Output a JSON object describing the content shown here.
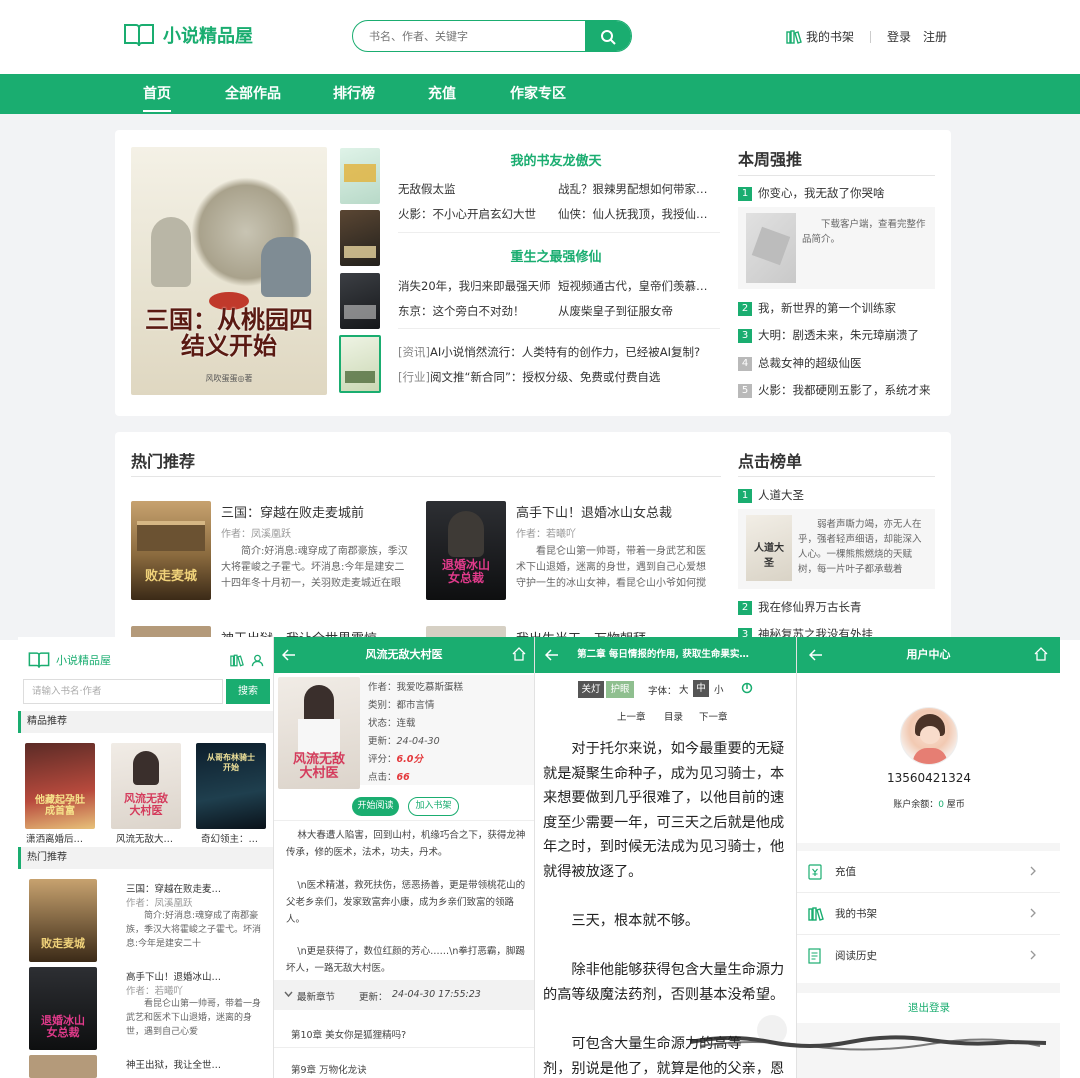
{
  "colors": {
    "brand": "#1aad70",
    "rank1": "#1aad70",
    "rank_other": "#b9b9b9",
    "red": "#e4393c"
  },
  "desktop": {
    "logo_text": "小说精品屋",
    "search_placeholder": "书名、作者、关键字",
    "header_links": {
      "bookshelf": "我的书架",
      "login": "登录",
      "register": "注册"
    },
    "nav": [
      "首页",
      "全部作品",
      "排行榜",
      "充值",
      "作家专区"
    ],
    "banner": {
      "cover_title": "三国：从桃园四结义开始",
      "cover_author": "风吹蛋蛋◎著"
    },
    "featured": [
      {
        "title": "我的书友龙傲天",
        "links": [
          [
            "无敌假太监",
            "战乱？狠辣男配想如何带家…"
          ],
          [
            "火影：不小心开启玄幻大世",
            "仙侠：仙人抚我顶，我授仙…"
          ]
        ]
      },
      {
        "title": "重生之最强修仙",
        "links": [
          [
            "消失20年，我归来即最强天师",
            "短视频通古代，皇帝们羡慕…"
          ],
          [
            "东京：这个旁白不对劲！",
            "从废柴皇子到征服女帝"
          ]
        ]
      }
    ],
    "news": [
      {
        "tag": "[资讯]",
        "text": "AI小说悄然流行：人类特有的创作力，已经被AI复制?"
      },
      {
        "tag": "[行业]",
        "text": "阅文推“新合同”：授权分级、免费或付费自选"
      }
    ],
    "weekly": {
      "title": "本周强推",
      "first": {
        "rank": "1",
        "title": "你变心，我无敌了你哭啥",
        "desc": "下载客户端，查看完整作品简介。"
      },
      "rest": [
        {
          "rank": "2",
          "title": "我，新世界的第一个训练家"
        },
        {
          "rank": "3",
          "title": "大明：剧透未来，朱元璋崩溃了"
        },
        {
          "rank": "4",
          "title": "总裁女神的超级仙医"
        },
        {
          "rank": "5",
          "title": "火影：我都硬刚五影了，系统才来"
        }
      ]
    },
    "hot": {
      "title": "热门推荐",
      "books": [
        {
          "title": "三国：穿越在败走麦城前",
          "author": "作者：凤溪凰跃",
          "desc": "简介:好消息:魂穿成了南郡豪族，季汉大将霍峻之子霍弋。坏消息:今年是建安二十四年冬十月初一，关羽败走麦城近在眼前。"
        },
        {
          "title": "高手下山！退婚冰山女总裁",
          "author": "作者：若曦吖",
          "desc": "看昆仑山第一帅哥，带着一身武艺和医术下山退婚，迷离的身世，遇到自己心爱想守护一生的冰山女神，看昆仑山小爷如何搅"
        }
      ],
      "partial": [
        "神王出狱，我让全世界震惊",
        "我出生当天，万物朝拜"
      ]
    },
    "click_rank": {
      "title": "点击榜单",
      "first": {
        "rank": "1",
        "title": "人道大圣",
        "desc": "弱者声嘶力竭，亦无人在乎，强者轻声细语，却能深入人心。一棵熊熊燃烧的天赋树，每一片叶子都承载着"
      },
      "rest": [
        {
          "rank": "2",
          "title": "我在修仙界万古长青"
        },
        {
          "rank": "3",
          "title": "神秘复苏之我没有外挂"
        }
      ]
    }
  },
  "m1": {
    "logo": "小说精品屋",
    "search_placeholder": "请输入书名·作者",
    "search_btn": "搜索",
    "sec1": "精品推荐",
    "covers": [
      "潇洒离婚后…",
      "风流无敌大…",
      "奇幻领主：…"
    ],
    "sec2": "热门推荐",
    "books": [
      {
        "title": "三国：穿越在败走麦…",
        "author": "作者：凤溪凰跃",
        "desc": "简介:好消息:魂穿成了南郡豪族，季汉大将霍峻之子霍弋。坏消息:今年是建安二十"
      },
      {
        "title": "高手下山！退婚冰山…",
        "author": "作者：若曦吖",
        "desc": "看昆仑山第一帅哥，带着一身武艺和医术下山退婚，迷离的身世，遇到自己心爱"
      },
      {
        "title": "神王出狱，我让全世…",
        "author": "",
        "desc": ""
      }
    ]
  },
  "m2": {
    "title": "风流无敌大村医",
    "info": [
      {
        "k": "作者：",
        "v": "我爱吃慕斯蛋糕"
      },
      {
        "k": "类别：",
        "v": "都市言情"
      },
      {
        "k": "状态：",
        "v": "连载"
      },
      {
        "k": "更新：",
        "v": "24-04-30"
      },
      {
        "k": "评分：",
        "v": "6.0分"
      },
      {
        "k": "点击：",
        "v": "66"
      }
    ],
    "btn_read": "开始阅读",
    "btn_shelf": "加入书架",
    "intro": [
      "林大春遭人陷害，回到山村，机缘巧合之下，获得龙神传承，修的医术，法术，功夫，丹术。",
      "\\n医术精湛，救死扶伤，惩恶扬善，更是带领桃花山的父老乡亲们，发家致富奔小康，成为乡亲们致富的领路人。",
      "\\n更是获得了，数位红颜的芳心……\\n拳打恶霸，脚踢坏人，一路无敌大村医。"
    ],
    "latest_label": "最新章节",
    "update_label": "更新：",
    "update_time": "24-04-30 17:55:23",
    "chapters": [
      "第10章 美女你是狐狸精吗?",
      "第9章 万物化龙诀"
    ]
  },
  "m3": {
    "title": "第二章 每日情报的作用, 获取生命果实…",
    "btn_light": "关灯",
    "btn_eye": "护眼",
    "font_label": "字体：",
    "font_sizes": [
      "大",
      "中",
      "小"
    ],
    "nav": [
      "上一章",
      "目录",
      "下一章"
    ],
    "paras": [
      "对于托尔来说，如今最重要的无疑就是凝聚生命种子，成为见习骑士，本来想要做到几乎很难了，以他目前的速度至少需要一年，可三天之后就是他成年之时，到时候无法成为见习骑士，他就得被放逐了。",
      "三天，根本就不够。",
      "除非他能够获得包含大量生命源力的高等级魔法药剂，否则基本没希望。",
      "可包含大量生命源力的高等",
      "剂，别说是他了，就算是他的父亲，恩"
    ]
  },
  "m4": {
    "title": "用户中心",
    "phone": "13560421324",
    "balance_label": "账户余额：",
    "balance": "0",
    "balance_unit": " 屋币",
    "menu": [
      "充值",
      "我的书架",
      "阅读历史"
    ],
    "logout": "退出登录"
  }
}
